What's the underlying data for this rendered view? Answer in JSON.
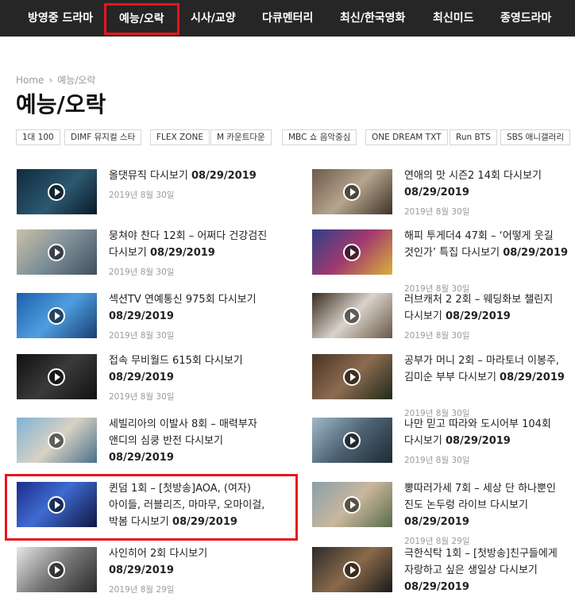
{
  "nav": {
    "items": [
      "방영중 드라마",
      "예능/오락",
      "시사/교양",
      "다큐멘터리",
      "최신/한국영화",
      "최신미드",
      "종영드라마"
    ]
  },
  "breadcrumb": {
    "home": "Home",
    "sep": "›",
    "current": "예능/오락"
  },
  "page_title": "예능/오락",
  "tags": [
    "1대 100",
    "DIMF 뮤지컬 스타",
    "FLEX ZONE",
    "M 카운트다운",
    "MBC 쇼 음악중심",
    "ONE DREAM TXT",
    "Run BTS",
    "SBS 애니갤러리"
  ],
  "left_items": [
    {
      "title": "올댓뮤직 다시보기",
      "date_strong": "08/29/2019",
      "posted": "2019년 8월 30일"
    },
    {
      "title": "뭉쳐야 찬다 12회 – 어쩌다 건강검진 다시보기",
      "date_strong": "08/29/2019",
      "posted": "2019년 8월 30일"
    },
    {
      "title": "섹션TV 연예통신 975회 다시보기",
      "date_strong": "08/29/2019",
      "posted": "2019년 8월 30일"
    },
    {
      "title": "접속 무비월드 615회 다시보기",
      "date_strong": "08/29/2019",
      "posted": "2019년 8월 30일"
    },
    {
      "title": "세빌리아의 이발사 8회 – 매력부자 앤디의 심쿵 반전 다시보기",
      "date_strong": "08/29/2019",
      "posted": "2019년 8월 30일"
    },
    {
      "title": "퀸덤 1회 – [첫방송]AOA, (여자)아이들, 러블리즈, 마마무, 오마이걸, 박봄 다시보기",
      "date_strong": "08/29/2019",
      "posted": "2019년 8월 29일"
    },
    {
      "title": "사인히어 2회 다시보기",
      "date_strong": "08/29/2019",
      "posted": "2019년 8월 29일"
    }
  ],
  "right_items": [
    {
      "title": "연애의 맛 시즌2 14회 다시보기",
      "date_strong": "08/29/2019",
      "posted": "2019년 8월 30일"
    },
    {
      "title": "해피 투게더4 47회 – ‘어떻게 웃길 것인가’ 특집 다시보기",
      "date_strong": "08/29/2019",
      "posted": "2019년 8월 30일"
    },
    {
      "title": "러브캐처 2 2회 – 웨딩화보 챌린지 다시보기",
      "date_strong": "08/29/2019",
      "posted": "2019년 8월 30일"
    },
    {
      "title": "공부가 머니 2회 – 마라토너 이봉주, 김미순 부부 다시보기",
      "date_strong": "08/29/2019",
      "posted": "2019년 8월 30일"
    },
    {
      "title": "나만 믿고 따라와 도시어부 104회 다시보기",
      "date_strong": "08/29/2019",
      "posted": "2019년 8월 30일"
    },
    {
      "title": "뽕따러가세 7회 – 세상 단 하나뿐인 진도 논두렁 라이브 다시보기",
      "date_strong": "08/29/2019",
      "posted": "2019년 8월 29일"
    },
    {
      "title": "극한식탁 1회 – [첫방송]친구들에게 자랑하고 싶은 생일상 다시보기",
      "date_strong": "08/29/2019",
      "posted": ""
    }
  ],
  "colors": {
    "nav_bg": "#262626",
    "highlight": "#e8141d",
    "meta": "#9b9b9b"
  },
  "icons": {
    "play": "play-icon"
  }
}
